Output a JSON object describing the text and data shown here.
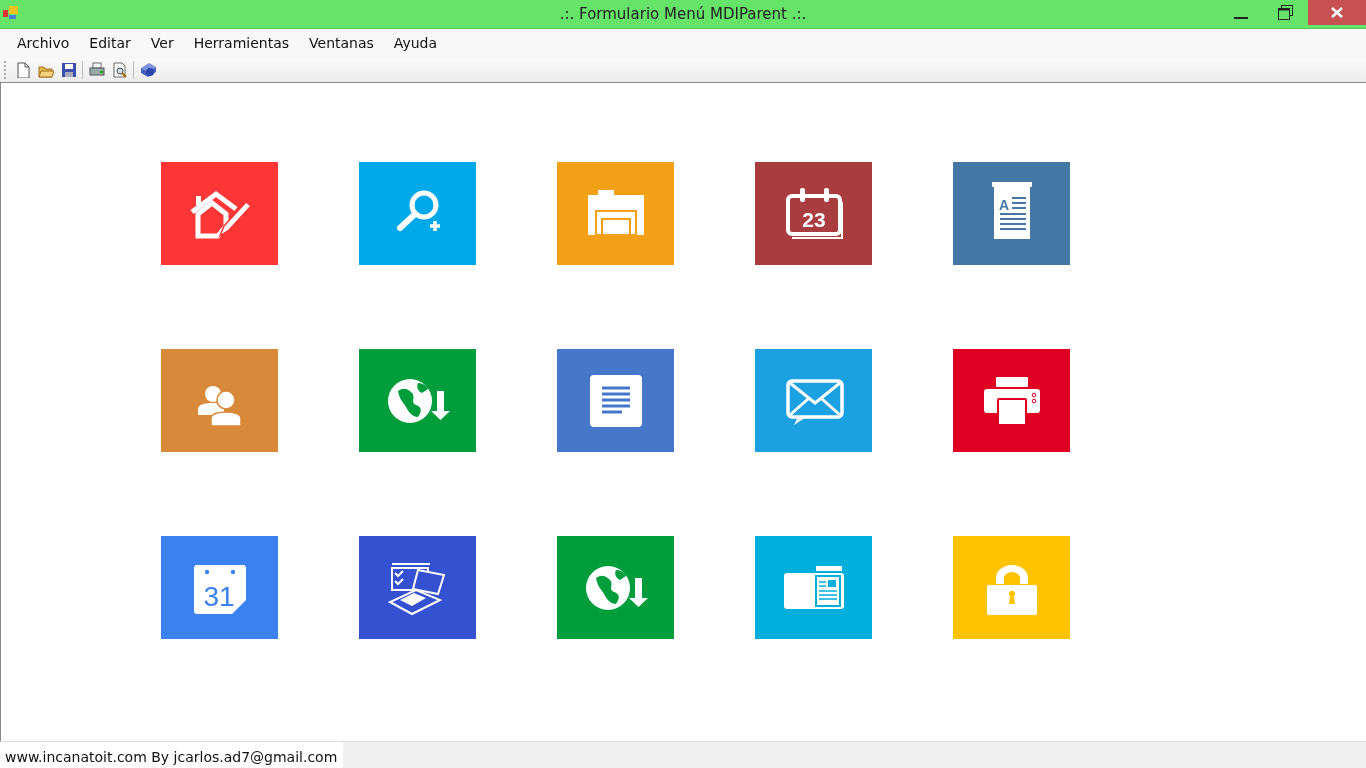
{
  "window": {
    "title": ".:. Formulario Menú MDIParent .:."
  },
  "menu": [
    "Archivo",
    "Editar",
    "Ver",
    "Herramientas",
    "Ventanas",
    "Ayuda"
  ],
  "toolbar": [
    {
      "kind": "new"
    },
    {
      "kind": "open"
    },
    {
      "kind": "save"
    },
    {
      "kind": "separator"
    },
    {
      "kind": "print"
    },
    {
      "kind": "preview"
    },
    {
      "kind": "separator"
    },
    {
      "kind": "help"
    }
  ],
  "tiles": [
    {
      "kind": "house",
      "color": "#ff3636"
    },
    {
      "kind": "search",
      "color": "#00a9ea"
    },
    {
      "kind": "folder",
      "color": "#f2a016"
    },
    {
      "kind": "calendar",
      "color": "#a93c3f",
      "text": "23"
    },
    {
      "kind": "document",
      "color": "#4477a4",
      "text": "A"
    },
    {
      "kind": "people",
      "color": "#d8893a"
    },
    {
      "kind": "globe",
      "color": "#009d3c"
    },
    {
      "kind": "notes",
      "color": "#4678c9"
    },
    {
      "kind": "mail",
      "color": "#1ba1e2"
    },
    {
      "kind": "printer",
      "color": "#e00023"
    },
    {
      "kind": "date",
      "color": "#3b82f0",
      "text": "31"
    },
    {
      "kind": "tasks",
      "color": "#3451d2"
    },
    {
      "kind": "globe",
      "color": "#009d3c"
    },
    {
      "kind": "card",
      "color": "#00afdb"
    },
    {
      "kind": "lock",
      "color": "#ffc300"
    }
  ],
  "status_bar": "www.incanatoit.com By jcarlos.ad7@gmail.com"
}
